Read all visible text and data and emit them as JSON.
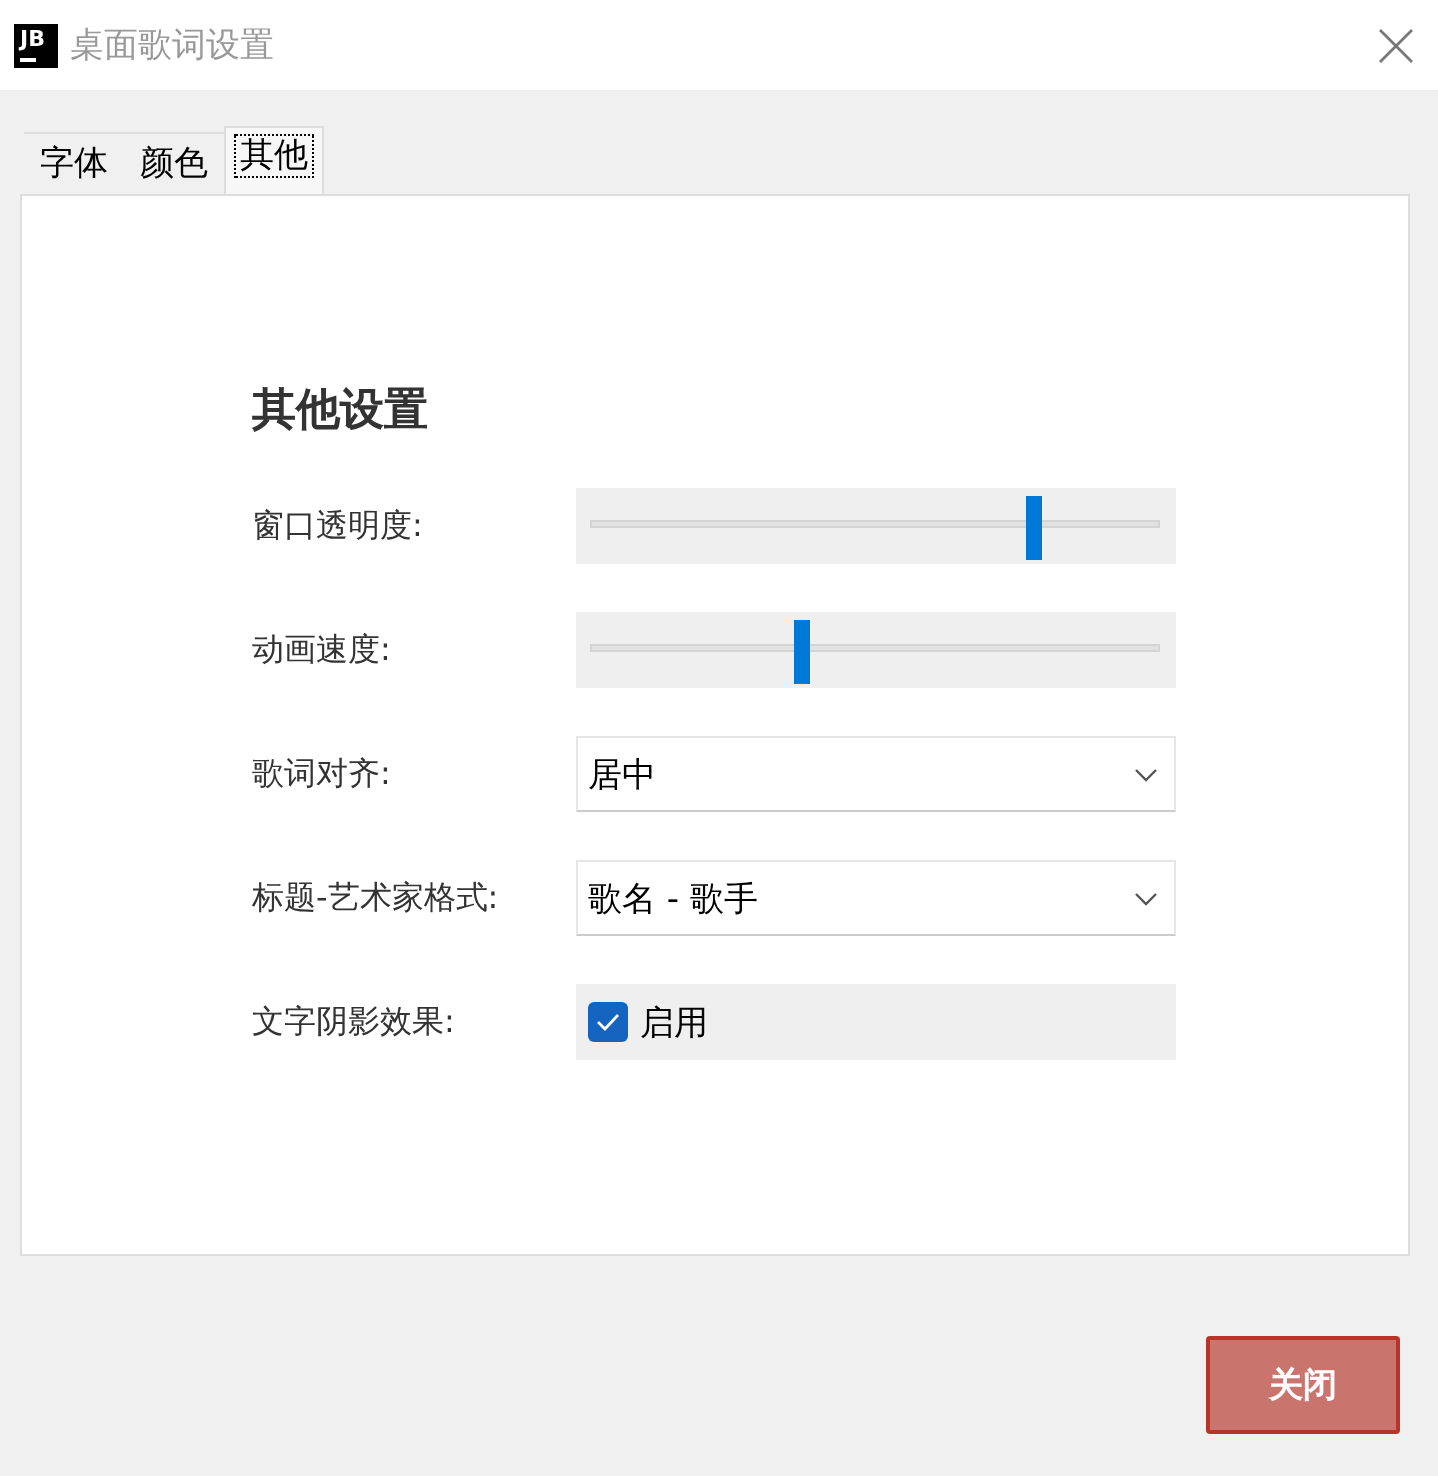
{
  "window": {
    "app_icon_text": "JB",
    "title": "桌面歌词设置"
  },
  "tabs": [
    {
      "label": "字体",
      "selected": false
    },
    {
      "label": "颜色",
      "selected": false
    },
    {
      "label": "其他",
      "selected": true
    }
  ],
  "panel": {
    "heading": "其他设置",
    "rows": [
      {
        "kind": "slider",
        "label": "窗口透明度:",
        "level": 0.78
      },
      {
        "kind": "slider",
        "label": "动画速度:",
        "level": 0.37
      },
      {
        "kind": "dropdown",
        "label": "歌词对齐:",
        "value": "居中"
      },
      {
        "kind": "dropdown",
        "label": "标题-艺术家格式:",
        "value": "歌名 - 歌手"
      },
      {
        "kind": "checkbox",
        "label": "文字阴影效果:",
        "text": "启用",
        "checked": true
      }
    ]
  },
  "buttons": [
    {
      "label": "关闭",
      "disabled": true
    }
  ]
}
